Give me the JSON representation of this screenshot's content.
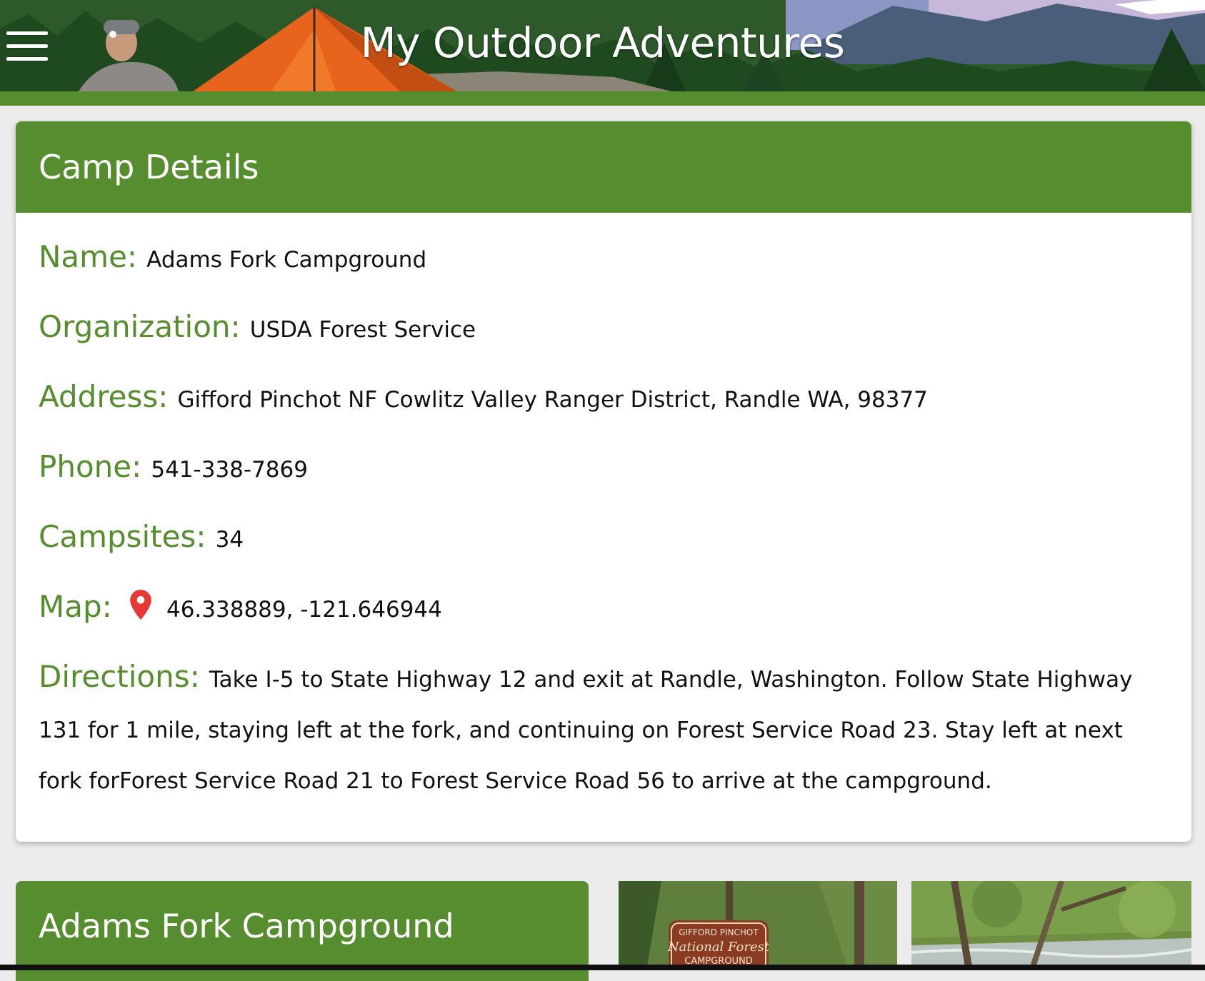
{
  "header": {
    "menu_icon": "hamburger-menu-icon",
    "title": "My Outdoor Adventures"
  },
  "camp_details": {
    "heading": "Camp Details",
    "name_label": "Name:",
    "name_value": "Adams Fork Campground",
    "organization_label": "Organization:",
    "organization_value": "USDA Forest Service",
    "address_label": "Address:",
    "address_value": "Gifford Pinchot NF Cowlitz Valley Ranger District, Randle WA, 98377",
    "phone_label": "Phone:",
    "phone_value": "541-338-7869",
    "campsites_label": "Campsites:",
    "campsites_value": "34",
    "map_label": "Map:",
    "map_icon": "map-pin-icon",
    "map_value": "46.338889, -121.646944",
    "directions_label": "Directions:",
    "directions_value": "Take I-5 to State Highway 12 and exit at Randle, Washington. Follow State Highway 131 for 1 mile, staying left at the fork, and continuing on Forest Service Road 23. Stay left at next fork forForest Service Road 21 to Forest Service Road 56 to arrive at the campground."
  },
  "bottom": {
    "campground_title": "Adams Fork Campground",
    "sign_line1": "GIFFORD PINCHOT",
    "sign_line2": "National Forest",
    "sign_line3": "CAMPGROUND"
  },
  "colors": {
    "accent_green": "#568d2f",
    "pin_red": "#e53935"
  }
}
